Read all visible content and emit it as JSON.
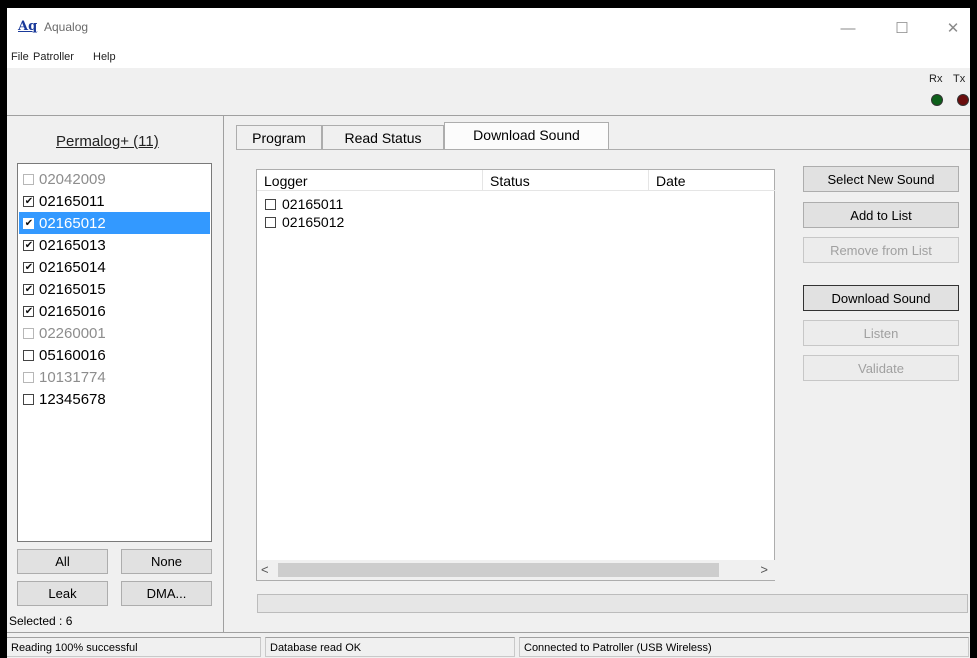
{
  "window": {
    "title": "Aqualog",
    "icon_text": "Aq",
    "controls": {
      "minimize": "—",
      "maximize": "☐",
      "close": "✕"
    }
  },
  "menu": [
    "File",
    "Patroller",
    "Help"
  ],
  "indicators": {
    "rx": {
      "label": "Rx",
      "color": "#0d5f1a"
    },
    "tx": {
      "label": "Tx",
      "color": "#6b0d0d"
    }
  },
  "left_panel": {
    "group_title": "Permalog+ (11)",
    "loggers": [
      {
        "id": "02042009",
        "checked": false,
        "enabled": false,
        "selected": false
      },
      {
        "id": "02165011",
        "checked": true,
        "enabled": true,
        "selected": false
      },
      {
        "id": "02165012",
        "checked": true,
        "enabled": true,
        "selected": true
      },
      {
        "id": "02165013",
        "checked": true,
        "enabled": true,
        "selected": false
      },
      {
        "id": "02165014",
        "checked": true,
        "enabled": true,
        "selected": false
      },
      {
        "id": "02165015",
        "checked": true,
        "enabled": true,
        "selected": false
      },
      {
        "id": "02165016",
        "checked": true,
        "enabled": true,
        "selected": false
      },
      {
        "id": "02260001",
        "checked": false,
        "enabled": false,
        "selected": false
      },
      {
        "id": "05160016",
        "checked": false,
        "enabled": true,
        "selected": false
      },
      {
        "id": "10131774",
        "checked": false,
        "enabled": false,
        "selected": false
      },
      {
        "id": "12345678",
        "checked": false,
        "enabled": true,
        "selected": false
      }
    ],
    "buttons": {
      "all": "All",
      "none": "None",
      "leak": "Leak",
      "dma": "DMA..."
    },
    "selected_count": "Selected : 6"
  },
  "tabs": [
    "Program",
    "Read Status",
    "Download Sound"
  ],
  "active_tab": "Download Sound",
  "download_list": {
    "columns": [
      "Logger",
      "Status",
      "Date"
    ],
    "rows": [
      {
        "logger": "02165011",
        "status": "",
        "date": ""
      },
      {
        "logger": "02165012",
        "status": "",
        "date": ""
      }
    ],
    "scroll_left": "<",
    "scroll_right": ">"
  },
  "actions": {
    "select_new_sound": "Select New Sound",
    "add_to_list": "Add to List",
    "remove_from_list": "Remove from List",
    "download_sound": "Download Sound",
    "listen": "Listen",
    "validate": "Validate"
  },
  "status_bar": [
    "Reading 100% successful",
    "Database read OK",
    "Connected to Patroller (USB Wireless)"
  ]
}
